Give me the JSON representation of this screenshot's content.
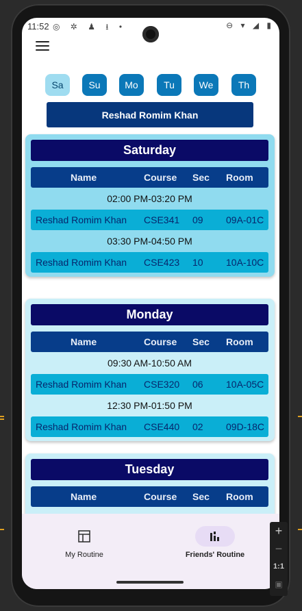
{
  "status_bar": {
    "time": "11:52",
    "left_icons": "◎ ✲ ♟ ⭳ •",
    "right_icons": "⊖ ▾ ◢ ▮"
  },
  "day_chips": [
    {
      "label": "Sa",
      "active": true
    },
    {
      "label": "Su",
      "active": false
    },
    {
      "label": "Mo",
      "active": false
    },
    {
      "label": "Tu",
      "active": false
    },
    {
      "label": "We",
      "active": false
    },
    {
      "label": "Th",
      "active": false
    }
  ],
  "friend_name": "Reshad Romim Khan",
  "columns": {
    "name": "Name",
    "course": "Course",
    "sec": "Sec",
    "room": "Room"
  },
  "days": [
    {
      "title": "Saturday",
      "color": "#90dbef",
      "entries": [
        {
          "time": "02:00 PM-03:20 PM",
          "name": "Reshad Romim Khan",
          "course": "CSE341",
          "sec": "09",
          "room": "09A-01C"
        },
        {
          "time": "03:30 PM-04:50 PM",
          "name": "Reshad Romim Khan",
          "course": "CSE423",
          "sec": "10",
          "room": "10A-10C"
        }
      ]
    },
    {
      "title": "Monday",
      "color": "#caeff8",
      "entries": [
        {
          "time": "09:30 AM-10:50 AM",
          "name": "Reshad Romim Khan",
          "course": "CSE320",
          "sec": "06",
          "room": "10A-05C"
        },
        {
          "time": "12:30 PM-01:50 PM",
          "name": "Reshad Romim Khan",
          "course": "CSE440",
          "sec": "02",
          "room": "09D-18C"
        }
      ]
    },
    {
      "title": "Tuesday",
      "color": "#caeff8",
      "entries": []
    }
  ],
  "bottom_nav": [
    {
      "label": "My Routine",
      "icon": "table-icon",
      "active": false
    },
    {
      "label": "Friends' Routine",
      "icon": "friends-chart-icon",
      "active": true
    }
  ],
  "emulator_toolbar": {
    "zoom_in": "+",
    "zoom_out": "−",
    "ratio": "1:1",
    "screenshot": "▣"
  }
}
